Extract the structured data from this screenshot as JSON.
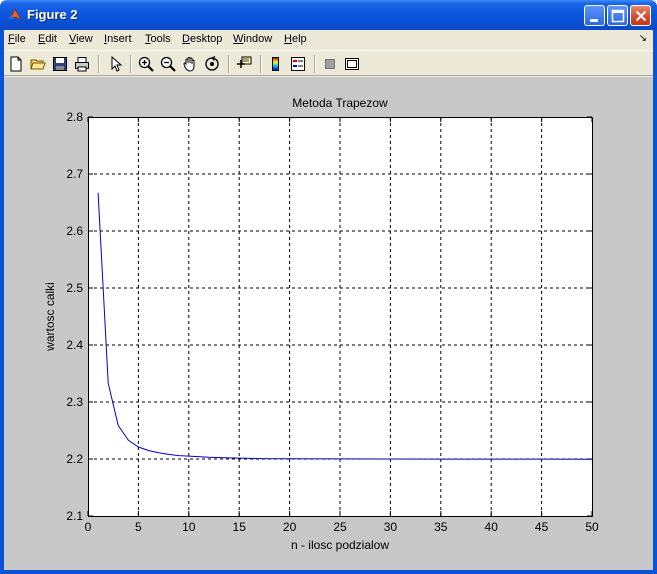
{
  "window": {
    "title": "Figure 2"
  },
  "menu": {
    "items": [
      {
        "first": "F",
        "rest": "ile"
      },
      {
        "first": "E",
        "rest": "dit"
      },
      {
        "first": "V",
        "rest": "iew"
      },
      {
        "first": "I",
        "rest": "nsert"
      },
      {
        "first": "T",
        "rest": "ools"
      },
      {
        "first": "D",
        "rest": "esktop"
      },
      {
        "first": "W",
        "rest": "indow"
      },
      {
        "first": "H",
        "rest": "elp"
      }
    ],
    "dock_arrow": "↘"
  },
  "toolbar": {
    "icons": [
      "new-figure-icon",
      "open-file-icon",
      "save-icon",
      "print-icon",
      "select-arrow-icon",
      "zoom-in-icon",
      "zoom-out-icon",
      "pan-hand-icon",
      "rotate-3d-icon",
      "data-cursor-icon",
      "colorbar-icon",
      "legend-icon",
      "hide-plot-tools-icon",
      "show-plot-tools-icon"
    ]
  },
  "colors": {
    "line": "#0000cc",
    "figure_bg": "#c8c8c8",
    "axes_bg": "#ffffff"
  },
  "chart_data": {
    "type": "line",
    "title": "Metoda Trapezow",
    "xlabel": "n - ilosc podzialow",
    "ylabel": "wartosc calki",
    "xlim": [
      0,
      50
    ],
    "ylim": [
      2.1,
      2.8
    ],
    "xticks": [
      0,
      5,
      10,
      15,
      20,
      25,
      30,
      35,
      40,
      45,
      50
    ],
    "yticks": [
      2.1,
      2.2,
      2.3,
      2.4,
      2.5,
      2.6,
      2.7,
      2.8
    ],
    "grid": true,
    "series": [
      {
        "x": [
          1,
          2,
          3,
          4,
          5,
          6,
          7,
          8,
          9,
          10,
          12,
          14,
          16,
          18,
          20,
          25,
          30,
          35,
          40,
          45,
          50
        ],
        "y": [
          2.667,
          2.333,
          2.259,
          2.233,
          2.221,
          2.215,
          2.211,
          2.208,
          2.206,
          2.205,
          2.203,
          2.202,
          2.201,
          2.2005,
          2.2003,
          2.2001,
          2.2,
          2.1999,
          2.1998,
          2.1998,
          2.1997
        ]
      }
    ]
  }
}
